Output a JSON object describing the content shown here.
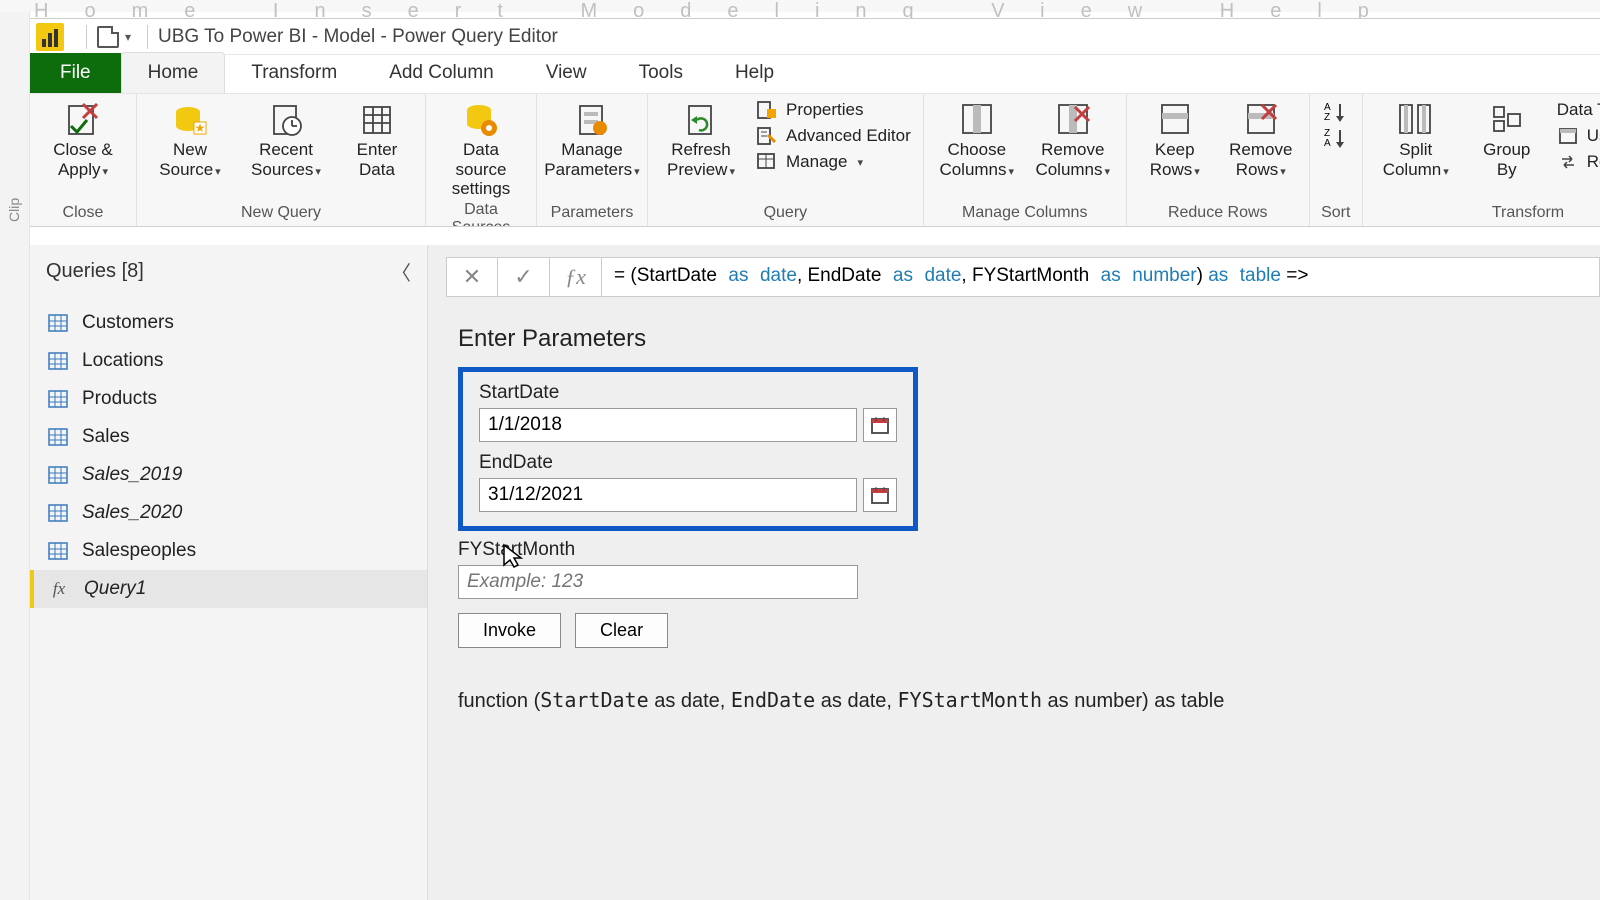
{
  "outer_tabs": "Home    Insert    Modeling    View    Help",
  "side_label": "Clip",
  "title": "UBG To Power BI - Model - Power Query Editor",
  "tabs": {
    "file": "File",
    "home": "Home",
    "transform": "Transform",
    "addcol": "Add Column",
    "view": "View",
    "tools": "Tools",
    "help": "Help"
  },
  "ribbon": {
    "close_apply": "Close &\nApply",
    "close_group": "Close",
    "new_source": "New\nSource",
    "recent_sources": "Recent\nSources",
    "enter_data": "Enter\nData",
    "new_query_group": "New Query",
    "data_source": "Data source\nsettings",
    "data_sources_group": "Data Sources",
    "manage_params": "Manage\nParameters",
    "parameters_group": "Parameters",
    "refresh": "Refresh\nPreview",
    "properties": "Properties",
    "adv_editor": "Advanced Editor",
    "manage": "Manage",
    "query_group": "Query",
    "choose_cols": "Choose\nColumns",
    "remove_cols": "Remove\nColumns",
    "manage_cols_group": "Manage Columns",
    "keep_rows": "Keep\nRows",
    "remove_rows": "Remove\nRows",
    "reduce_rows_group": "Reduce Rows",
    "sort_group": "Sort",
    "split_col": "Split\nColumn",
    "group_by": "Group\nBy",
    "data_type": "Data Type: Any",
    "first_row": "Use First Ro",
    "replace": "Replace Val",
    "transform_group": "Transform"
  },
  "queries": {
    "header": "Queries [8]",
    "items": [
      {
        "label": "Customers",
        "type": "table"
      },
      {
        "label": "Locations",
        "type": "table"
      },
      {
        "label": "Products",
        "type": "table"
      },
      {
        "label": "Sales",
        "type": "table"
      },
      {
        "label": "Sales_2019",
        "type": "table",
        "italic": true
      },
      {
        "label": "Sales_2020",
        "type": "table",
        "italic": true
      },
      {
        "label": "Salespeoples",
        "type": "table"
      },
      {
        "label": "Query1",
        "type": "fx",
        "italic": true,
        "selected": true
      }
    ]
  },
  "formula": {
    "eq": "= (",
    "p1": "StartDate",
    "as1": "as",
    "t1": "date",
    "c1": ", ",
    "p2": "EndDate",
    "as2": "as",
    "t2": "date",
    "c2": ", ",
    "p3": "FYStartMonth",
    "as3": "as",
    "t3": "number",
    "cl": ") ",
    "as4": "as",
    "t4": "table",
    "arrow": " =>"
  },
  "params": {
    "heading": "Enter Parameters",
    "start_label": "StartDate",
    "start_value": "1/1/2018",
    "end_label": "EndDate",
    "end_value": "31/12/2021",
    "fy_label": "FYStartMonth",
    "fy_placeholder": "Example: 123",
    "invoke": "Invoke",
    "clear": "Clear"
  },
  "signature": {
    "pre": "function (",
    "p1": "StartDate",
    "a1": " as date, ",
    "p2": "EndDate",
    "a2": " as date, ",
    "p3": "FYStartMonth",
    "a3": " as number) as table"
  }
}
